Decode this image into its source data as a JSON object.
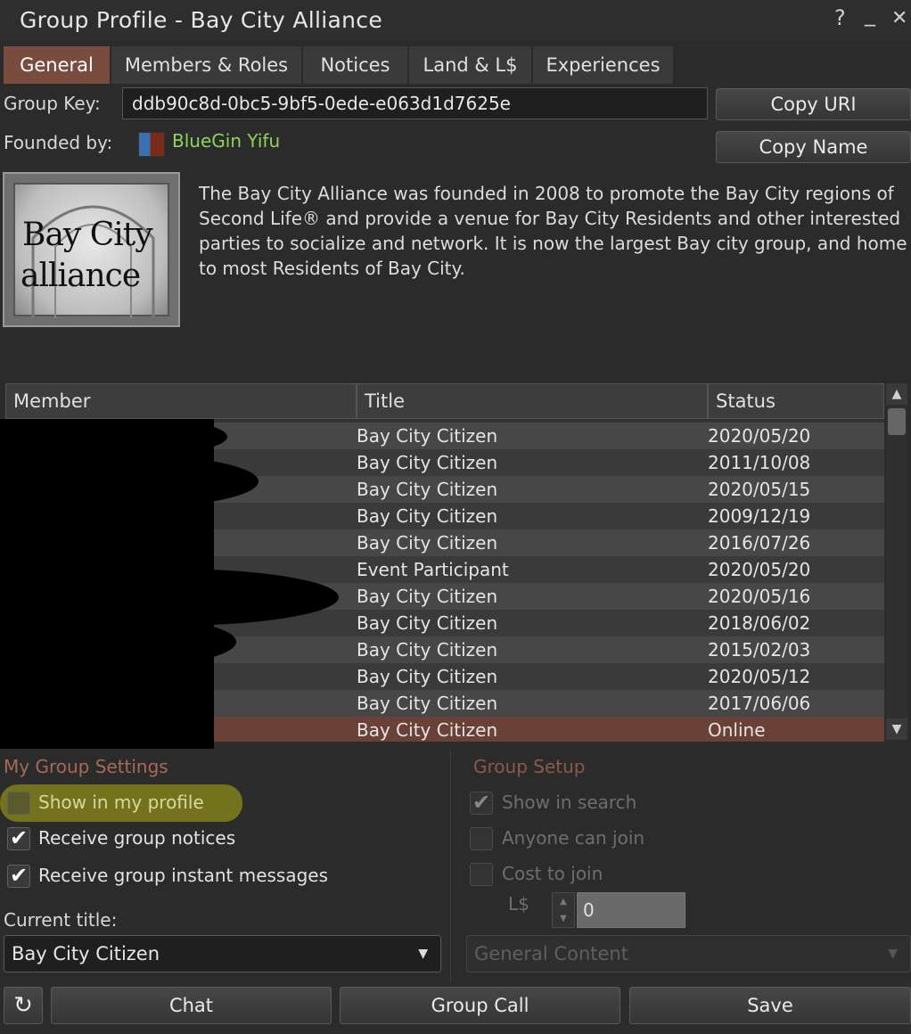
{
  "window": {
    "title": "Group Profile - Bay City Alliance",
    "help_glyph": "?",
    "minimize_glyph": "_",
    "close_glyph": "✕"
  },
  "tabs": [
    {
      "label": "General",
      "active": true
    },
    {
      "label": "Members & Roles",
      "active": false
    },
    {
      "label": "Notices",
      "active": false
    },
    {
      "label": "Land & L$",
      "active": false
    },
    {
      "label": "Experiences",
      "active": false
    }
  ],
  "group_key": {
    "label": "Group Key:",
    "value": "ddb90c8d-0bc5-9bf5-0ede-e063d1d7625e"
  },
  "founded_by": {
    "label": "Founded by:",
    "name": "BlueGin Yifu"
  },
  "buttons": {
    "copy_uri": "Copy URI",
    "copy_name": "Copy Name",
    "chat": "Chat",
    "group_call": "Group Call",
    "save": "Save"
  },
  "logo": {
    "line1": "Bay City",
    "line2": "alliance"
  },
  "description": "The Bay City Alliance was founded in 2008 to promote the Bay City regions of Second Life® and provide a venue for Bay City Residents and other interested parties to socialize and network. It is now the largest Bay city group, and home to most Residents of Bay City.",
  "members_table": {
    "columns": [
      "Member",
      "Title",
      "Status"
    ],
    "rows": [
      {
        "title": "Bay City Citizen",
        "status": "2020/05/20"
      },
      {
        "title": "Bay City Citizen",
        "status": "2011/10/08"
      },
      {
        "title": "Bay City Citizen",
        "status": "2020/05/15"
      },
      {
        "title": "Bay City Citizen",
        "status": "2009/12/19"
      },
      {
        "title": "Bay City Citizen",
        "status": "2016/07/26"
      },
      {
        "title": "Event Participant",
        "status": "2020/05/20"
      },
      {
        "title": "Bay City Citizen",
        "status": "2020/05/16"
      },
      {
        "title": "Bay City Citizen",
        "status": "2018/06/02"
      },
      {
        "title": "Bay City Citizen",
        "status": "2015/02/03"
      },
      {
        "title": "Bay City Citizen",
        "status": "2020/05/12"
      },
      {
        "title": "Bay City Citizen",
        "status": "2017/06/06"
      },
      {
        "title": "Bay City Citizen",
        "status": "Online",
        "selected": true
      }
    ]
  },
  "my_group_settings": {
    "title": "My Group Settings",
    "show_in_profile": {
      "label": "Show in my profile",
      "checked": false
    },
    "receive_notices": {
      "label": "Receive group notices",
      "checked": true
    },
    "receive_ims": {
      "label": "Receive group instant messages",
      "checked": true
    },
    "current_title_label": "Current title:",
    "current_title_value": "Bay City Citizen"
  },
  "group_setup": {
    "title": "Group Setup",
    "show_in_search": {
      "label": "Show in search",
      "checked": true
    },
    "anyone_can_join": {
      "label": "Anyone can join",
      "checked": false
    },
    "cost_to_join": {
      "label": "Cost to join",
      "checked": false
    },
    "currency_label": "L$",
    "cost_value": "0",
    "maturity_value": "General Content"
  },
  "colors": {
    "active_tab": "#7a4c3e",
    "founder_link": "#8fd35a",
    "section_title": "#a66a55",
    "selected_row": "#6a4136",
    "highlight": "#8c8c1a"
  }
}
